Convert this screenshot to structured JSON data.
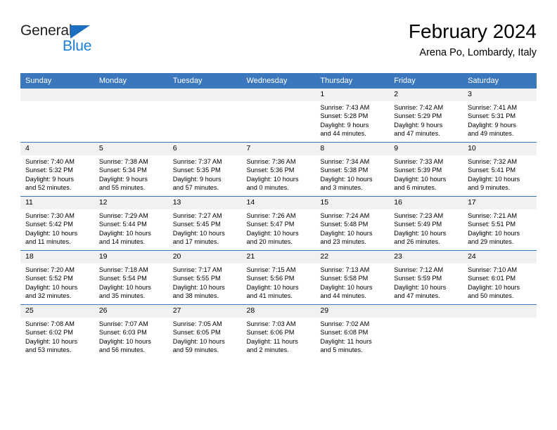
{
  "brand": {
    "name_part1": "General",
    "name_part2": "Blue",
    "triangle_color": "#1c6fc0",
    "blue_color": "#1c7fd6"
  },
  "header": {
    "title": "February 2024",
    "subtitle": "Arena Po, Lombardy, Italy",
    "header_bg": "#3a77bc",
    "daynum_bg": "#f1f1f1"
  },
  "weekday_headers": [
    "Sunday",
    "Monday",
    "Tuesday",
    "Wednesday",
    "Thursday",
    "Friday",
    "Saturday"
  ],
  "labels": {
    "sunrise_prefix": "Sunrise:",
    "sunset_prefix": "Sunset:",
    "daylight_prefix": "Daylight:"
  },
  "weeks": [
    [
      {
        "day": "",
        "blank": true
      },
      {
        "day": "",
        "blank": true
      },
      {
        "day": "",
        "blank": true
      },
      {
        "day": "",
        "blank": true
      },
      {
        "day": "1",
        "sunrise": "Sunrise: 7:43 AM",
        "sunset": "Sunset: 5:28 PM",
        "daylight_line1": "Daylight: 9 hours",
        "daylight_line2": "and 44 minutes."
      },
      {
        "day": "2",
        "sunrise": "Sunrise: 7:42 AM",
        "sunset": "Sunset: 5:29 PM",
        "daylight_line1": "Daylight: 9 hours",
        "daylight_line2": "and 47 minutes."
      },
      {
        "day": "3",
        "sunrise": "Sunrise: 7:41 AM",
        "sunset": "Sunset: 5:31 PM",
        "daylight_line1": "Daylight: 9 hours",
        "daylight_line2": "and 49 minutes."
      }
    ],
    [
      {
        "day": "4",
        "sunrise": "Sunrise: 7:40 AM",
        "sunset": "Sunset: 5:32 PM",
        "daylight_line1": "Daylight: 9 hours",
        "daylight_line2": "and 52 minutes."
      },
      {
        "day": "5",
        "sunrise": "Sunrise: 7:38 AM",
        "sunset": "Sunset: 5:34 PM",
        "daylight_line1": "Daylight: 9 hours",
        "daylight_line2": "and 55 minutes."
      },
      {
        "day": "6",
        "sunrise": "Sunrise: 7:37 AM",
        "sunset": "Sunset: 5:35 PM",
        "daylight_line1": "Daylight: 9 hours",
        "daylight_line2": "and 57 minutes."
      },
      {
        "day": "7",
        "sunrise": "Sunrise: 7:36 AM",
        "sunset": "Sunset: 5:36 PM",
        "daylight_line1": "Daylight: 10 hours",
        "daylight_line2": "and 0 minutes."
      },
      {
        "day": "8",
        "sunrise": "Sunrise: 7:34 AM",
        "sunset": "Sunset: 5:38 PM",
        "daylight_line1": "Daylight: 10 hours",
        "daylight_line2": "and 3 minutes."
      },
      {
        "day": "9",
        "sunrise": "Sunrise: 7:33 AM",
        "sunset": "Sunset: 5:39 PM",
        "daylight_line1": "Daylight: 10 hours",
        "daylight_line2": "and 6 minutes."
      },
      {
        "day": "10",
        "sunrise": "Sunrise: 7:32 AM",
        "sunset": "Sunset: 5:41 PM",
        "daylight_line1": "Daylight: 10 hours",
        "daylight_line2": "and 9 minutes."
      }
    ],
    [
      {
        "day": "11",
        "sunrise": "Sunrise: 7:30 AM",
        "sunset": "Sunset: 5:42 PM",
        "daylight_line1": "Daylight: 10 hours",
        "daylight_line2": "and 11 minutes."
      },
      {
        "day": "12",
        "sunrise": "Sunrise: 7:29 AM",
        "sunset": "Sunset: 5:44 PM",
        "daylight_line1": "Daylight: 10 hours",
        "daylight_line2": "and 14 minutes."
      },
      {
        "day": "13",
        "sunrise": "Sunrise: 7:27 AM",
        "sunset": "Sunset: 5:45 PM",
        "daylight_line1": "Daylight: 10 hours",
        "daylight_line2": "and 17 minutes."
      },
      {
        "day": "14",
        "sunrise": "Sunrise: 7:26 AM",
        "sunset": "Sunset: 5:47 PM",
        "daylight_line1": "Daylight: 10 hours",
        "daylight_line2": "and 20 minutes."
      },
      {
        "day": "15",
        "sunrise": "Sunrise: 7:24 AM",
        "sunset": "Sunset: 5:48 PM",
        "daylight_line1": "Daylight: 10 hours",
        "daylight_line2": "and 23 minutes."
      },
      {
        "day": "16",
        "sunrise": "Sunrise: 7:23 AM",
        "sunset": "Sunset: 5:49 PM",
        "daylight_line1": "Daylight: 10 hours",
        "daylight_line2": "and 26 minutes."
      },
      {
        "day": "17",
        "sunrise": "Sunrise: 7:21 AM",
        "sunset": "Sunset: 5:51 PM",
        "daylight_line1": "Daylight: 10 hours",
        "daylight_line2": "and 29 minutes."
      }
    ],
    [
      {
        "day": "18",
        "sunrise": "Sunrise: 7:20 AM",
        "sunset": "Sunset: 5:52 PM",
        "daylight_line1": "Daylight: 10 hours",
        "daylight_line2": "and 32 minutes."
      },
      {
        "day": "19",
        "sunrise": "Sunrise: 7:18 AM",
        "sunset": "Sunset: 5:54 PM",
        "daylight_line1": "Daylight: 10 hours",
        "daylight_line2": "and 35 minutes."
      },
      {
        "day": "20",
        "sunrise": "Sunrise: 7:17 AM",
        "sunset": "Sunset: 5:55 PM",
        "daylight_line1": "Daylight: 10 hours",
        "daylight_line2": "and 38 minutes."
      },
      {
        "day": "21",
        "sunrise": "Sunrise: 7:15 AM",
        "sunset": "Sunset: 5:56 PM",
        "daylight_line1": "Daylight: 10 hours",
        "daylight_line2": "and 41 minutes."
      },
      {
        "day": "22",
        "sunrise": "Sunrise: 7:13 AM",
        "sunset": "Sunset: 5:58 PM",
        "daylight_line1": "Daylight: 10 hours",
        "daylight_line2": "and 44 minutes."
      },
      {
        "day": "23",
        "sunrise": "Sunrise: 7:12 AM",
        "sunset": "Sunset: 5:59 PM",
        "daylight_line1": "Daylight: 10 hours",
        "daylight_line2": "and 47 minutes."
      },
      {
        "day": "24",
        "sunrise": "Sunrise: 7:10 AM",
        "sunset": "Sunset: 6:01 PM",
        "daylight_line1": "Daylight: 10 hours",
        "daylight_line2": "and 50 minutes."
      }
    ],
    [
      {
        "day": "25",
        "sunrise": "Sunrise: 7:08 AM",
        "sunset": "Sunset: 6:02 PM",
        "daylight_line1": "Daylight: 10 hours",
        "daylight_line2": "and 53 minutes."
      },
      {
        "day": "26",
        "sunrise": "Sunrise: 7:07 AM",
        "sunset": "Sunset: 6:03 PM",
        "daylight_line1": "Daylight: 10 hours",
        "daylight_line2": "and 56 minutes."
      },
      {
        "day": "27",
        "sunrise": "Sunrise: 7:05 AM",
        "sunset": "Sunset: 6:05 PM",
        "daylight_line1": "Daylight: 10 hours",
        "daylight_line2": "and 59 minutes."
      },
      {
        "day": "28",
        "sunrise": "Sunrise: 7:03 AM",
        "sunset": "Sunset: 6:06 PM",
        "daylight_line1": "Daylight: 11 hours",
        "daylight_line2": "and 2 minutes."
      },
      {
        "day": "29",
        "sunrise": "Sunrise: 7:02 AM",
        "sunset": "Sunset: 6:08 PM",
        "daylight_line1": "Daylight: 11 hours",
        "daylight_line2": "and 5 minutes."
      },
      {
        "day": "",
        "blank": true
      },
      {
        "day": "",
        "blank": true
      }
    ]
  ]
}
